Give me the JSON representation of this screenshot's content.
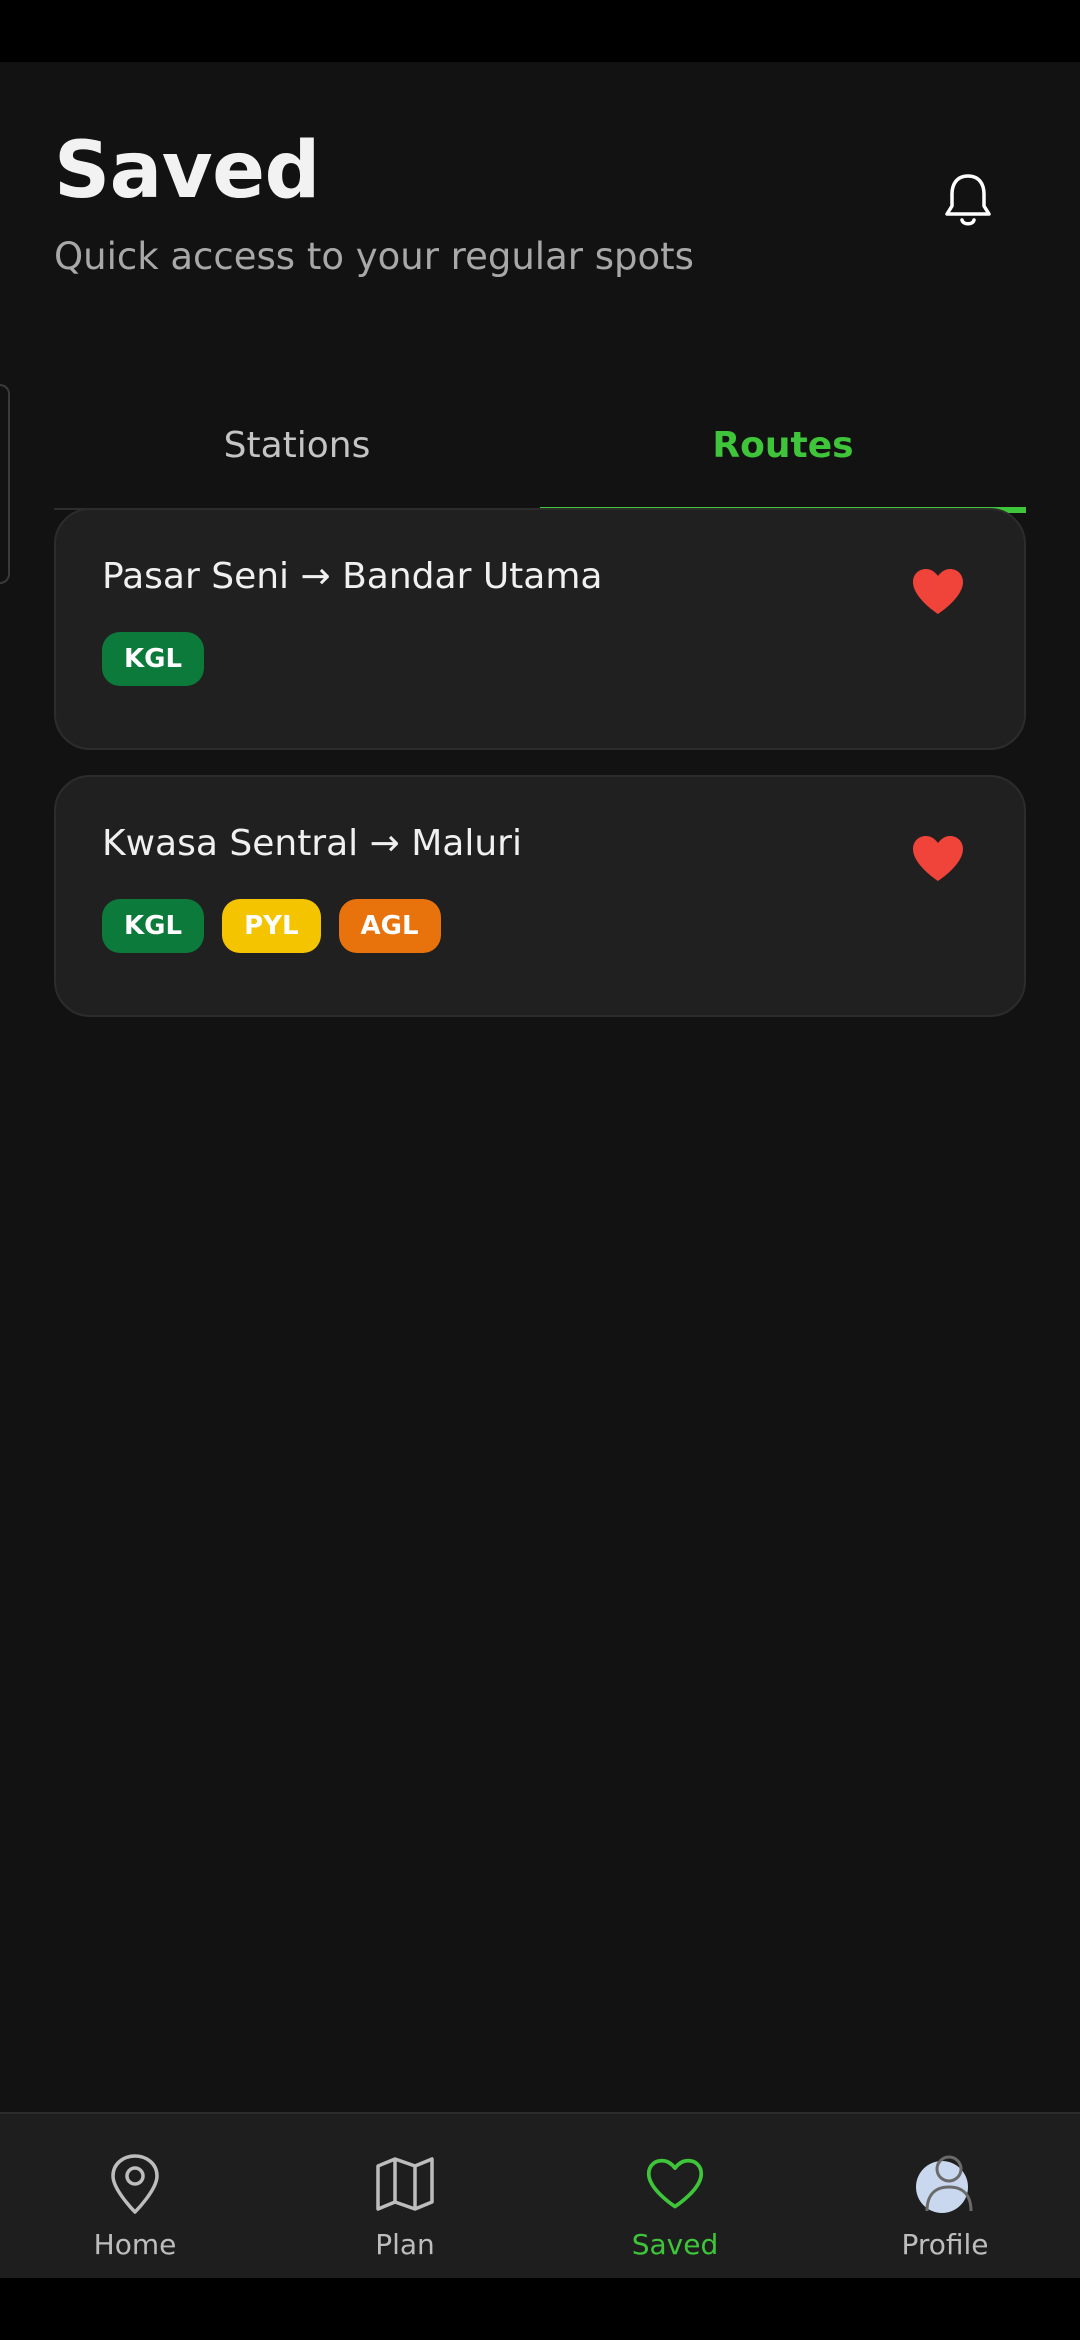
{
  "header": {
    "title": "Saved",
    "subtitle": "Quick access to your regular spots",
    "notification_icon": "bell-icon"
  },
  "tabs": [
    {
      "label": "Stations",
      "active": false
    },
    {
      "label": "Routes",
      "active": true
    }
  ],
  "routes": [
    {
      "title": "Pasar Seni → Bandar Utama",
      "lines": [
        {
          "code": "KGL",
          "color": "#0b7a3b"
        }
      ],
      "favorite_icon": "heart-filled-icon"
    },
    {
      "title": "Kwasa Sentral → Maluri",
      "lines": [
        {
          "code": "KGL",
          "color": "#0b7a3b"
        },
        {
          "code": "PYL",
          "color": "#f5c400"
        },
        {
          "code": "AGL",
          "color": "#e8720c"
        }
      ],
      "favorite_icon": "heart-filled-icon"
    }
  ],
  "bottom_nav": [
    {
      "label": "Home",
      "icon": "map-pin-icon",
      "active": false
    },
    {
      "label": "Plan",
      "icon": "map-icon",
      "active": false
    },
    {
      "label": "Saved",
      "icon": "heart-icon",
      "active": true
    },
    {
      "label": "Profile",
      "icon": "avatar-icon",
      "active": false
    }
  ],
  "colors": {
    "accent": "#3ec53a",
    "favorite": "#f0433a",
    "background": "#121212",
    "card": "#202020"
  }
}
